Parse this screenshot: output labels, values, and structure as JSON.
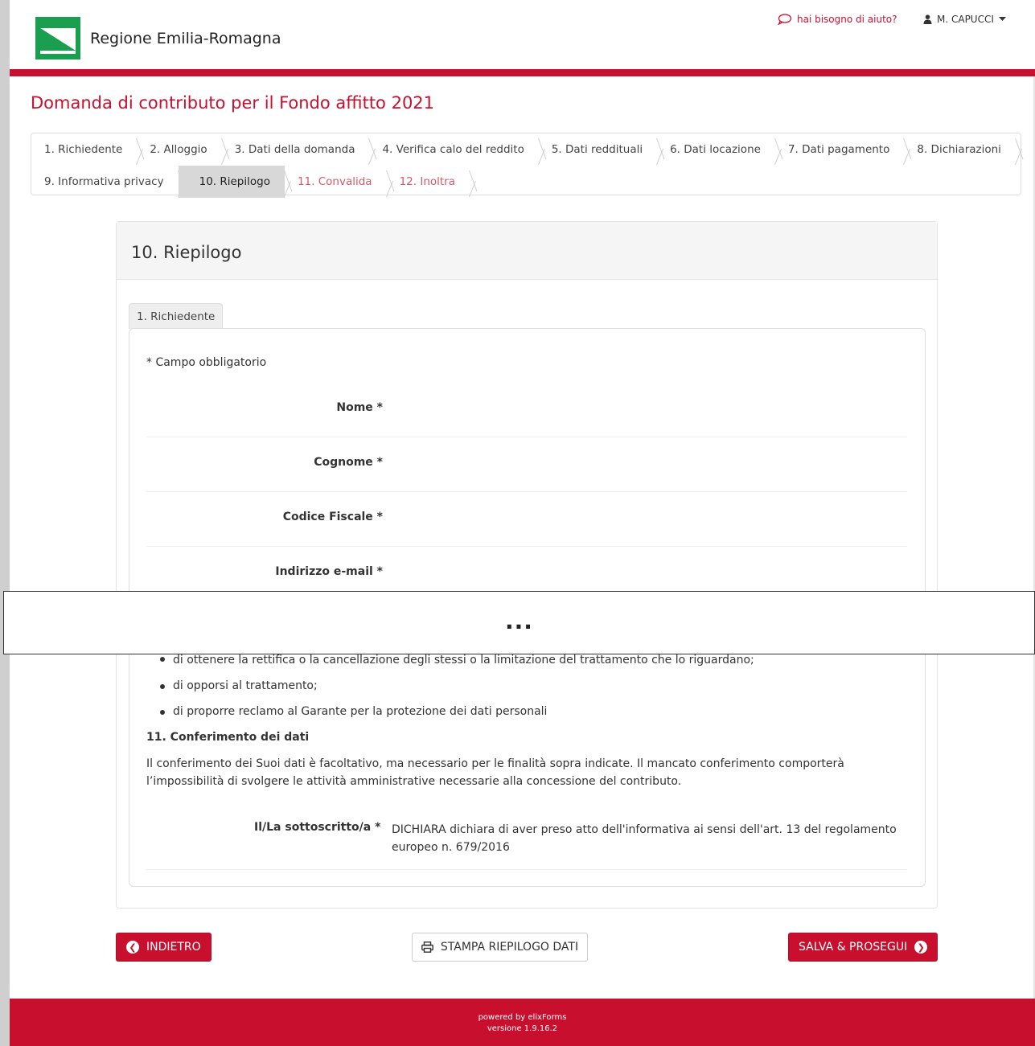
{
  "header": {
    "brand": "Regione Emilia-Romagna",
    "help_link": "hai bisogno di aiuto?",
    "user_name": "M. CAPUCCI",
    "accent_color": "#c8102e",
    "logo_colors": [
      "#1a9e50",
      "#ffffff"
    ]
  },
  "page_title": "Domanda di contributo per il Fondo affitto 2021",
  "steps_row1": [
    {
      "label": "1. Richiedente",
      "state": "done"
    },
    {
      "label": "2. Alloggio",
      "state": "done"
    },
    {
      "label": "3. Dati della domanda",
      "state": "done"
    },
    {
      "label": "4. Verifica calo del reddito",
      "state": "done"
    },
    {
      "label": "5. Dati reddituali",
      "state": "done"
    },
    {
      "label": "6. Dati locazione",
      "state": "done"
    },
    {
      "label": "7. Dati pagamento",
      "state": "done"
    },
    {
      "label": "8. Dichiarazioni",
      "state": "done"
    }
  ],
  "steps_row2": [
    {
      "label": "9. Informativa privacy",
      "state": "done"
    },
    {
      "label": "10. Riepilogo",
      "state": "active"
    },
    {
      "label": "11. Convalida",
      "state": "disabled"
    },
    {
      "label": "12. Inoltra",
      "state": "disabled"
    }
  ],
  "panel": {
    "title": "10. Riepilogo",
    "tab": "1. Richiedente",
    "required_note": "* Campo obbligatorio",
    "fields": [
      {
        "label": "Nome *"
      },
      {
        "label": "Cognome *"
      },
      {
        "label": "Codice Fiscale *"
      },
      {
        "label": "Indirizzo e-mail *"
      }
    ],
    "ellipsis": "...",
    "cutoff_line": "di ottenere la rettifica o la cancellazione degli stessi o la limitazione del trattamento che lo riguardano;",
    "bullets": [
      "di opporsi al trattamento;",
      "di proporre reclamo al Garante per la protezione dei dati personali"
    ],
    "section_heading": "11. Conferimento dei dati",
    "paragraph": "Il conferimento dei Suoi dati è facoltativo, ma necessario per le finalità sopra indicate. Il mancato conferimento comporterà l’impossibilità di svolgere le attività amministrative necessarie alla concessione del contributo.",
    "declaration": {
      "label": "Il/La sottoscritto/a *",
      "text": "DICHIARA dichiara di aver preso atto dell'informativa ai sensi dell'art. 13 del regolamento europeo n. 679/2016"
    }
  },
  "buttons": {
    "back": "INDIETRO",
    "print": "STAMPA RIEPILOGO DATI",
    "next": "SALVA & PROSEGUI"
  },
  "footer": {
    "powered": "powered by elixForms",
    "version": "versione 1.9.16.2"
  }
}
